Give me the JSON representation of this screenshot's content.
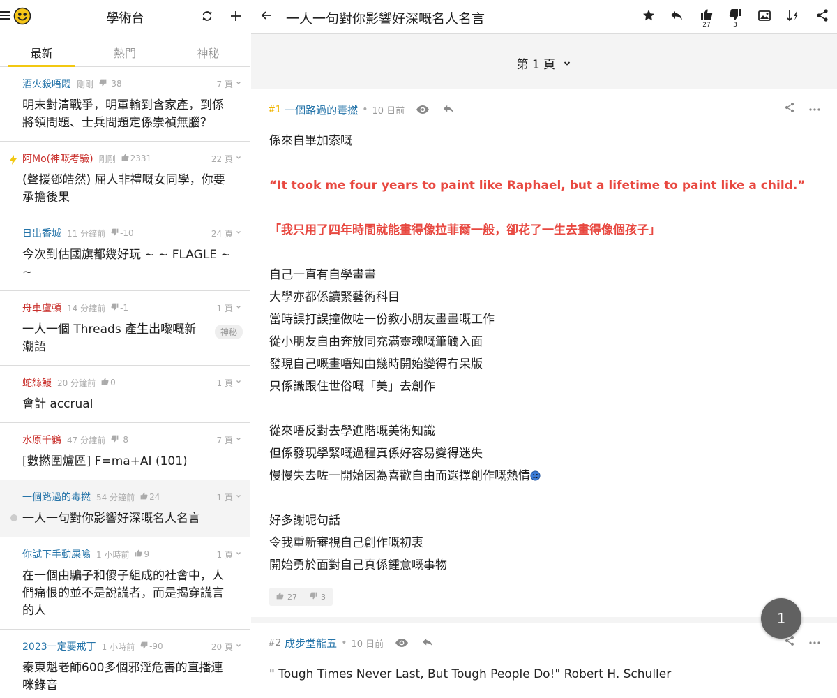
{
  "app": {
    "board_title": "學術台",
    "tabs": [
      "最新",
      "熱門",
      "神秘"
    ],
    "colors": {
      "accent": "#f2c811",
      "male": "#2574a9",
      "female": "#c9302c",
      "quote": "#e84840"
    }
  },
  "threads": [
    {
      "author": "酒火殺唔悶",
      "gender": "male",
      "time": "剛剛",
      "score": "-38",
      "vote": "down",
      "pages": "7 頁",
      "title": "明末對清戰爭，明軍輸到含家產，到係將領問題、士兵問題定係崇禎無腦？"
    },
    {
      "author": "阿Mo(神嘅考驗)",
      "gender": "female",
      "time": "剛剛",
      "score": "2331",
      "vote": "up",
      "pages": "22 頁",
      "title": "(聲援鄧皓然) 屈人非禮嘅女同學，你要承擔後果",
      "hot": true
    },
    {
      "author": "日出香城",
      "gender": "male",
      "time": "11 分鐘前",
      "score": "-10",
      "vote": "down",
      "pages": "24 頁",
      "title": "今次到估國旗都幾好玩 ~ ~ FLAGLE ~ ~"
    },
    {
      "author": "舟車盧頓",
      "gender": "female",
      "time": "14 分鐘前",
      "score": "-1",
      "vote": "down",
      "pages": "1 頁",
      "title": "一人一個 Threads 產生出嚟嘅新潮語",
      "tag": "神秘"
    },
    {
      "author": "蛇絲鰻",
      "gender": "female",
      "time": "20 分鐘前",
      "score": "0",
      "vote": "up",
      "pages": "1 頁",
      "title": "會計 accrual"
    },
    {
      "author": "水原千鶴",
      "gender": "female",
      "time": "47 分鐘前",
      "score": "-8",
      "vote": "down",
      "pages": "7 頁",
      "title": "[數撚圍爐區] F=ma+AI (101)"
    },
    {
      "author": "一個路過的毒撚",
      "gender": "male",
      "time": "54 分鐘前",
      "score": "24",
      "vote": "up",
      "pages": "1 頁",
      "title": "一人一句對你影響好深嘅名人名言",
      "selected": true
    },
    {
      "author": "你試下手動屎噏",
      "gender": "male",
      "time": "1 小時前",
      "score": "9",
      "vote": "up",
      "pages": "1 頁",
      "title": "在一個由騙子和傻子組成的社會中，人們痛恨的並不是說謊者，而是揭穿謊言的人"
    },
    {
      "author": "2023一定要戒丁",
      "gender": "male",
      "time": "1 小時前",
      "score": "-90",
      "vote": "down",
      "pages": "20 頁",
      "title": "秦東魁老師600多個邪淫危害的直播連咪錄音"
    }
  ],
  "topic": {
    "title": "一人一句對你影響好深嘅名人名言",
    "likes": "27",
    "dislikes": "3",
    "page_label": "第 1 頁",
    "fab_label": "1"
  },
  "posts": [
    {
      "num": "#1",
      "author": "一個路過的毒撚",
      "time": "10 日前",
      "likes": "27",
      "dislikes": "3",
      "lines": [
        {
          "text": "係來自畢加索嘅"
        },
        {
          "text": ""
        },
        {
          "text": "“It took me four years to paint like Raphael, but a lifetime to paint like a child.”",
          "red": true
        },
        {
          "text": ""
        },
        {
          "text": "「我只用了四年時間就能畫得像拉菲爾一般，卻花了一生去畫得像個孩子」",
          "red": true
        },
        {
          "text": ""
        },
        {
          "text": "自己一直有自學畫畫"
        },
        {
          "text": "大學亦都係讀緊藝術科目"
        },
        {
          "text": "當時誤打誤撞做咗一份教小朋友畫畫嘅工作"
        },
        {
          "text": "從小朋友自由奔放同充滿靈魂嘅筆觸入面"
        },
        {
          "text": "發現自己嘅畫唔知由幾時開始變得冇呆版"
        },
        {
          "text": "只係識跟住世俗嘅「美」去創作"
        },
        {
          "text": ""
        },
        {
          "text": "從來唔反對去學進階嘅美術知識"
        },
        {
          "text": "但係發現學緊嘅過程真係好容易變得迷失"
        },
        {
          "text": "慢慢失去咗一開始因為喜歡自由而選擇創作嘅熱情",
          "emoji": "sad-face"
        },
        {
          "text": ""
        },
        {
          "text": "好多謝呢句話"
        },
        {
          "text": "令我重新審視自己創作嘅初衷"
        },
        {
          "text": "開始勇於面對自己真係鍾意嘅事物"
        }
      ]
    },
    {
      "num": "#2",
      "author": "成步堂龍五",
      "time": "10 日前",
      "lines": [
        {
          "text": "\" Tough Times Never Last, But Tough People Do!\" Robert H. Schuller"
        }
      ]
    }
  ]
}
